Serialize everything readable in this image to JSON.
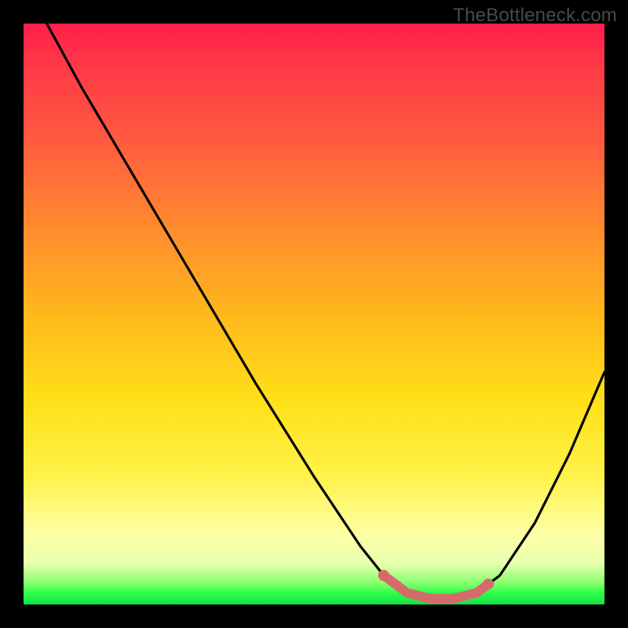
{
  "watermark": "TheBottleneck.com",
  "chart_data": {
    "type": "line",
    "title": "",
    "xlabel": "",
    "ylabel": "",
    "xlim": [
      0,
      100
    ],
    "ylim": [
      0,
      100
    ],
    "grid": false,
    "legend": false,
    "series": [
      {
        "name": "bottleneck-curve",
        "color": "#000000",
        "x": [
          4,
          10,
          20,
          30,
          40,
          50,
          58,
          62,
          66,
          70,
          74,
          78,
          82,
          88,
          94,
          100
        ],
        "y": [
          100,
          89,
          72,
          55,
          38,
          22,
          10,
          5,
          2,
          1,
          1,
          2,
          5,
          14,
          26,
          40
        ]
      }
    ],
    "highlight": {
      "name": "optimal-range",
      "color": "#d66a6a",
      "x": [
        62,
        66,
        70,
        74,
        78,
        80
      ],
      "y": [
        5,
        2,
        1,
        1,
        2,
        3.5
      ]
    },
    "background_gradient": {
      "top": "#ff1f4a",
      "mid": "#ffe018",
      "bottom": "#15e04a"
    }
  }
}
